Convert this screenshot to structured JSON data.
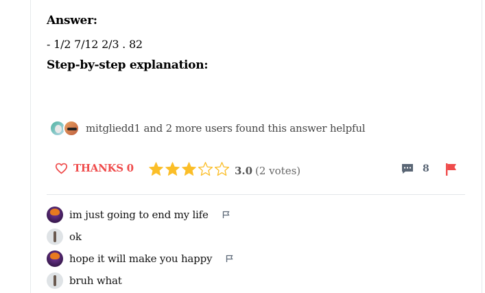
{
  "answer": {
    "heading": "Answer:",
    "body": "- 1/2 7/12 2/3 . 82",
    "steps_heading": "Step-by-step explanation:"
  },
  "helpful": {
    "text": "mitgliedd1 and 2 more users found this answer helpful"
  },
  "actions": {
    "thanks_label": "THANKS 0",
    "rating_value": 3.0,
    "rating_max": 5,
    "rating_text": "3.0",
    "votes_text": "(2 votes)",
    "comment_count": "8"
  },
  "comments": [
    {
      "text": "im just going to end my life",
      "avatar": "purple",
      "flaggable": true
    },
    {
      "text": "ok",
      "avatar": "grey",
      "flaggable": false
    },
    {
      "text": "hope it will make you happy",
      "avatar": "purple",
      "flaggable": true
    },
    {
      "text": "bruh what",
      "avatar": "grey",
      "flaggable": false
    }
  ],
  "colors": {
    "accent_red": "#ef4b4b",
    "star_gold": "#fbbe28",
    "icon_grey": "#5a6675"
  },
  "icons": {
    "thanks": "heart-icon",
    "comment": "comment-icon",
    "report": "flag-icon",
    "comment_report": "small-flag-icon"
  }
}
